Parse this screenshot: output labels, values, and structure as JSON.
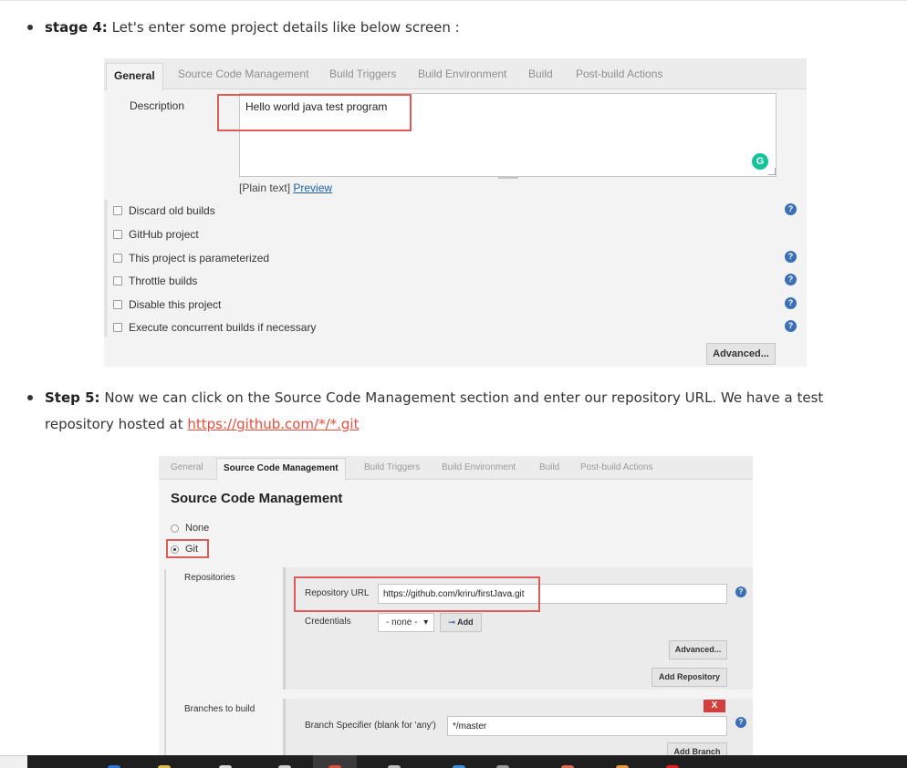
{
  "steps": [
    {
      "bold": "stage 4:",
      "text": " Let's enter some project details like below screen :"
    },
    {
      "bold": "Step 5:",
      "text": " Now we can click on the Source Code Management section and enter our repository URL. We have a test repository hosted at ",
      "link": "https://github.com/*/*.git"
    }
  ],
  "config1": {
    "tabs": [
      "General",
      "Source Code Management",
      "Build Triggers",
      "Build Environment",
      "Build",
      "Post-build Actions"
    ],
    "description_label": "Description",
    "description_value": "Hello world java test program",
    "grammarly_badge": "G",
    "plain_text": "[Plain text]",
    "preview_link": "Preview",
    "options": [
      "Discard old builds",
      "GitHub project",
      "This project is parameterized",
      "Throttle builds",
      "Disable this project",
      "Execute concurrent builds if necessary"
    ],
    "help_glyph": "?",
    "advanced_button": "Advanced..."
  },
  "config2": {
    "tabs": [
      "General",
      "Source Code Management",
      "Build Triggers",
      "Build Environment",
      "Build",
      "Post-build Actions"
    ],
    "section_title": "Source Code Management",
    "scm_options": [
      "None",
      "Git"
    ],
    "selected_scm": "Git",
    "repositories_label": "Repositories",
    "repo_url_label": "Repository URL",
    "repo_url_value": "https://github.com/kriru/firstJava.git",
    "credentials_label": "Credentials",
    "credentials_value": "- none -",
    "credentials_arrow": "▾",
    "add_button_icon": "key-icon",
    "add_button": "Add",
    "advanced_button": "Advanced...",
    "add_repository_button": "Add Repository",
    "branches_label": "Branches to build",
    "remove_button": "X",
    "branch_specifier_label": "Branch Specifier (blank for 'any')",
    "branch_specifier_value": "*/master",
    "add_branch_button": "Add Branch"
  },
  "colors": {
    "highlight_red": "#e05a57",
    "link_red": "#e74c3c",
    "help_blue": "#3b6fb6",
    "grammarly_green": "#15c39a"
  }
}
